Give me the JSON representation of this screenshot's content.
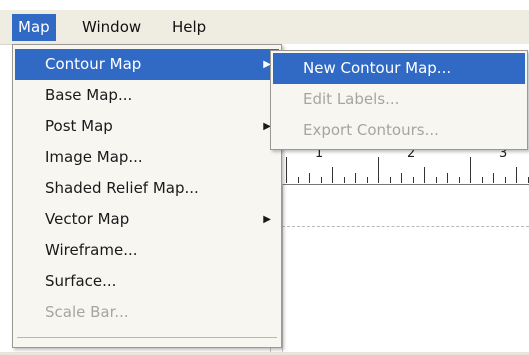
{
  "menubar": {
    "items": [
      {
        "label": "Map",
        "active": true
      },
      {
        "label": "Window",
        "active": false
      },
      {
        "label": "Help",
        "active": false
      }
    ]
  },
  "map_menu": {
    "items": [
      {
        "label": "Contour Map",
        "submenu": true,
        "highlighted": true,
        "disabled": false,
        "arrow": "▶"
      },
      {
        "label": "Base Map...",
        "submenu": false,
        "highlighted": false,
        "disabled": false
      },
      {
        "label": "Post Map",
        "submenu": true,
        "highlighted": false,
        "disabled": false,
        "arrow": "▶"
      },
      {
        "label": "Image Map...",
        "submenu": false,
        "highlighted": false,
        "disabled": false
      },
      {
        "label": "Shaded Relief Map...",
        "submenu": false,
        "highlighted": false,
        "disabled": false
      },
      {
        "label": "Vector Map",
        "submenu": true,
        "highlighted": false,
        "disabled": false,
        "arrow": "▶"
      },
      {
        "label": "Wireframe...",
        "submenu": false,
        "highlighted": false,
        "disabled": false
      },
      {
        "label": "Surface...",
        "submenu": false,
        "highlighted": false,
        "disabled": false
      },
      {
        "label": "Scale Bar...",
        "submenu": false,
        "highlighted": false,
        "disabled": true
      }
    ]
  },
  "contour_submenu": {
    "items": [
      {
        "label": "New Contour Map...",
        "highlighted": true,
        "disabled": false
      },
      {
        "label": "Edit Labels...",
        "highlighted": false,
        "disabled": true
      },
      {
        "label": "Export Contours...",
        "highlighted": false,
        "disabled": true
      }
    ]
  },
  "ruler": {
    "labels": [
      "1",
      "2",
      "3"
    ]
  },
  "colors": {
    "highlight": "#316ac5",
    "menu_bg": "#f7f6f1",
    "menubar_bg": "#efede2",
    "disabled_text": "#a6a59f"
  }
}
